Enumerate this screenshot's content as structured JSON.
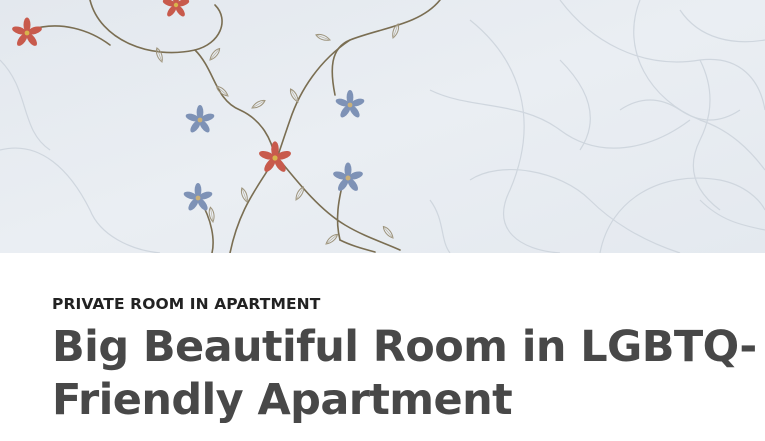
{
  "listing": {
    "room_type": "PRIVATE ROOM IN APARTMENT",
    "title_line1": "Big Beautiful Room in LGBTQ-",
    "title_line2": "Friendly Apartment"
  },
  "hero_image": {
    "icon": "embroidered-floral-quilt-photo",
    "colors": {
      "fabric": "#e7ecf1",
      "stitching": "#cdd4db",
      "vine": "#7a6e52",
      "flower_red": "#c85a4c",
      "flower_blue": "#7e92b6"
    }
  },
  "colors": {
    "eyebrow": "#222222",
    "title": "#484848",
    "background": "#ffffff"
  }
}
